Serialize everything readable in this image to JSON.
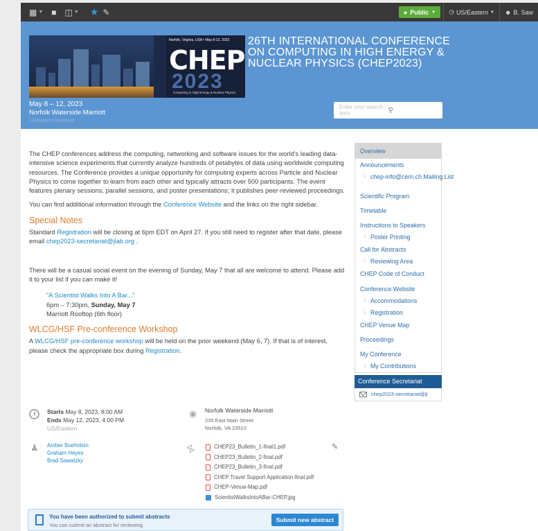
{
  "toolbar": {
    "public_label": "Public",
    "timezone": "US/Eastern",
    "user": "B. Saw"
  },
  "header": {
    "banner_tagline": "Norfolk, Virginia, USA • May 8-12, 2023",
    "banner_logo": "CHEP",
    "banner_year": "2023",
    "banner_subtitle": "Computing in High Energy & Nuclear Physics",
    "title": "26TH INTERNATIONAL CONFERENCE ON COMPUTING IN HIGH ENERGY & NUCLEAR PHYSICS (CHEP2023)",
    "dates": "May 8 – 12, 2023",
    "venue": "Norfolk Waterside Marriott",
    "timezone": "US/Eastern timezone",
    "search_placeholder": "Enter your search term"
  },
  "intro": {
    "paragraph": "The CHEP conferences address the computing, networking and software issues for the world's leading data-intensive science experiments that currently analyze hundreds of petabytes of data using worldwide computing resources. The Conference provides a unique opportunity for computing experts across Particle and Nuclear Physics to come together to learn from each other and typically attracts over 500 participants. The event features plenary sessions, parallel sessions, and poster presentations; it publishes peer-reviewed proceedings.",
    "info_before": "You can find additional information through the ",
    "info_link": "Conference Website",
    "info_after": " and the links on the right sidebar."
  },
  "special_notes": {
    "heading": "Special Notes",
    "text_before": "Standard ",
    "registration_link": "Registration",
    "text_mid": " will be closing at 6pm EDT on April 27. If you still need to register after that date, please email ",
    "email_link": "chep2023-secretariat@jlab.org",
    "text_after": " ."
  },
  "social": {
    "paragraph": "There will be a casual social event on the evening of Sunday, May 7 that all are welcome to attend.  Please add it to your list if you can make it!",
    "event_link": "\"A Scientist Walks Into A Bar...\"",
    "time_prefix": "6pm – 7:30pm, ",
    "time_day": "Sunday, May 7",
    "location": "Marriott Rooftop (6th floor)"
  },
  "workshop": {
    "heading": "WLCG/HSF Pre-conference Workshop",
    "text_before": "A ",
    "link": "WLCG/HSF pre-conference workshop",
    "text_mid": " will be held on the prior weekend (May 6, 7).  If that is of interest, please check the appropriate box during ",
    "registration_link": "Registration",
    "text_after": "."
  },
  "details": {
    "starts_label": "Starts",
    "starts": "May 8, 2023, 8:00 AM",
    "ends_label": "Ends",
    "ends": "May 12, 2023, 4:00 PM",
    "timezone": "US/Eastern",
    "venue_name": "Norfolk Waterside Marriott",
    "address_line1": "235 East Main Street",
    "address_line2": "Norfolk, VA 23510",
    "chairs": [
      "Amber Boehnlein",
      "Graham Heyes",
      "Brad Sawatzky"
    ],
    "files": [
      "CHEP23_Bulletin_1-final1.pdf",
      "CHEP23_Bulletin_2-final.pdf",
      "CHEP23_Bulletin_3-final.pdf",
      "CHEP Travel Support Application-final.pdf",
      "CHEP-Venue-Map.pdf",
      "ScientistWalksIntoABar-CHEP.jpg"
    ]
  },
  "abstracts": {
    "title": "You have been authorized to submit abstracts",
    "subtitle": "You can submit an abstract for reviewing.",
    "button": "Submit new abstract"
  },
  "sidebar": {
    "items": [
      "Overview",
      "Announcements",
      "chep-info@cern.ch Mailing List",
      "Scientific Program",
      "Timetable",
      "Instructions to Speakers",
      "Poster Printing",
      "Call for Abstracts",
      "Reviewing Area",
      "CHEP Code of Conduct",
      "Conference Website",
      "Accommodations",
      "Registration",
      "CHEP Venue Map",
      "Proceedings",
      "My Conference",
      "My Contributions"
    ],
    "secretariat_title": "Conference Secretariat",
    "secretariat_email": "chep2023-secretariat@jl"
  }
}
